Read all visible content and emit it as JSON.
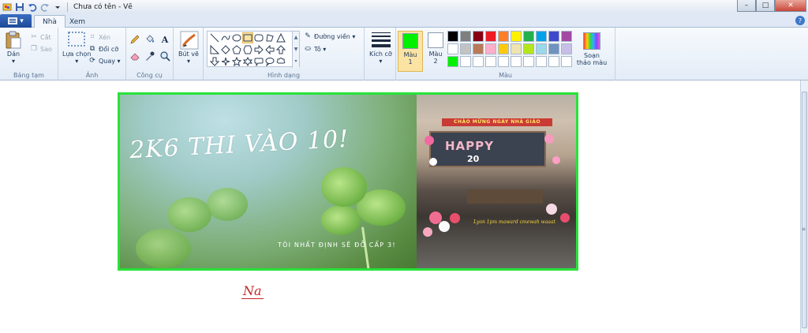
{
  "window": {
    "title": "Chưa có tên - Vẽ",
    "background_tabs": [
      "",
      "",
      ""
    ],
    "buttons": {
      "minimize": "–",
      "maximize": "□",
      "close": "✕"
    }
  },
  "tabs": {
    "menu_label": "▾",
    "items": [
      {
        "label": "Nhà"
      },
      {
        "label": "Xem"
      }
    ],
    "help": "?"
  },
  "ribbon": {
    "clipboard": {
      "label": "Bảng tạm",
      "paste": "Dán",
      "cut": "Cắt",
      "copy": "Sao"
    },
    "image": {
      "label": "Ảnh",
      "select": "Lựa chọn",
      "crop": "Xén",
      "resize": "Đổi cỡ",
      "rotate": "Quay"
    },
    "tools": {
      "label": "Công cụ",
      "text_tool": "A"
    },
    "brush": {
      "label": "Bút vẽ"
    },
    "shapes": {
      "label": "Hình dạng",
      "outline": "Đường viền",
      "fill": "Tô"
    },
    "size": {
      "label": "Kích cỡ"
    },
    "colors": {
      "label": "Màu",
      "color1_label": "Màu 1",
      "color2_label": "Màu 2",
      "color1": "#00f000",
      "color2": "#ffffff",
      "edit_label": "Soạn thảo màu",
      "palette_row1": [
        "#000000",
        "#7f7f7f",
        "#880015",
        "#ed1c24",
        "#ff7f27",
        "#fff200",
        "#22b14c",
        "#00a2e8",
        "#3f48cc",
        "#a349a4"
      ],
      "palette_row2": [
        "#ffffff",
        "#c3c3c3",
        "#b97a57",
        "#ffaec9",
        "#ffc90e",
        "#efe4b0",
        "#b5e61d",
        "#99d9ea",
        "#7092be",
        "#c8bfe7"
      ],
      "palette_row3": [
        "#00f000",
        "#ffffff",
        "#ffffff",
        "#ffffff",
        "#ffffff",
        "#ffffff",
        "#ffffff",
        "#ffffff",
        "#ffffff",
        "#ffffff"
      ]
    }
  },
  "canvas": {
    "headline": "2K6 THI VÀO 10!",
    "subline": "TÔI NHẤT ĐỊNH SẼ ĐỖ CẤP 3!",
    "banner_text": "CHÀO MỪNG NGÀY NHÀ GIÁO",
    "happy_text": "HAPPY",
    "number_text": "20",
    "caption_text": "Lyon 1pm maward cmewah waaat",
    "signature": "Na",
    "border_color": "#27e33a"
  }
}
